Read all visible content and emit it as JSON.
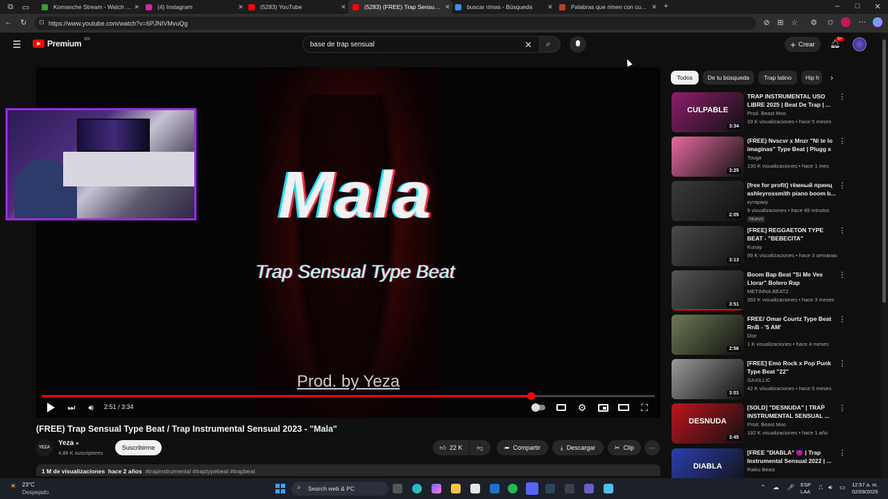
{
  "browser": {
    "tabs": [
      {
        "label": "Komanche Stream - Watch Live o",
        "color": "#3c9a3c",
        "active": false
      },
      {
        "label": "(4) Instagram",
        "color": "#d6249f",
        "active": false
      },
      {
        "label": "(5283) YouTube",
        "color": "#ff0000",
        "active": false
      },
      {
        "label": "(5283) (FREE) Trap Sensual Type Be",
        "color": "#ff0000",
        "active": true
      },
      {
        "label": "buscar rimas - Búsqueda",
        "color": "#3a8ee6",
        "active": false
      },
      {
        "label": "Palabras que rimen con cuello - L",
        "color": "#c0392b",
        "active": false
      }
    ],
    "url": "https://www.youtube.com/watch?v=6PJNIVMvuQg"
  },
  "header": {
    "logo_label": "Premium",
    "region": "MX",
    "search_value": "base de trap sensual",
    "create_label": "Crear",
    "notifications_badge": "9+"
  },
  "player": {
    "big_title": "Mala",
    "subtitle": "Trap Sensual Type Beat",
    "prod": "Prod. by Yeza",
    "time": "2:51 / 3:34",
    "progress": 0.797
  },
  "video": {
    "title": "(FREE) Trap Sensual Type Beat / Trap Instrumental Sensual 2023 - \"Mala\"",
    "channel": "Yeza",
    "channel_avatar_text": "YEZA",
    "subscribers": "4,86 K suscriptores",
    "subscribe_label": "Suscribirme",
    "likes": "22 K",
    "share_label": "Compartir",
    "download_label": "Descargar",
    "clip_label": "Clip",
    "views": "1 M de visualizaciones",
    "age": "hace 2 años",
    "tags": "#trapinstrumental #traptypebeat #trapbeat"
  },
  "chips": [
    "Todos",
    "De tu búsqueda",
    "Trap latino",
    "Hip h"
  ],
  "recommendations": [
    {
      "title": "TRAP INSTRUMENTAL USO LIBRE 2025 | Beat De Trap | ...",
      "channel": "Prod. Beast Moo",
      "views": "33 K visualizaciones",
      "age": "hace 5 meses",
      "duration": "3:34",
      "thumb_text": "CULPABLE",
      "thumb_color": "#8e1d6d",
      "badge": "",
      "watched": 0
    },
    {
      "title": "(FREE) Nvscvr x Mnzr \"Ni te lo imaginas\" Type Beat | Plugg x ...",
      "channel": "Touga",
      "views": "130 K visualizaciones",
      "age": "hace 1 mes",
      "duration": "3:25",
      "thumb_text": "",
      "thumb_color": "#e86aa0",
      "badge": "",
      "watched": 0
    },
    {
      "title": "[free for profit] тёмный принц ashleyrossmith piano boom b...",
      "channel": "кутараку",
      "views": "9 visualizaciones",
      "age": "hace 49 minutos",
      "duration": "2:05",
      "thumb_text": "",
      "thumb_color": "#3a3a3a",
      "badge": "Nuevo",
      "watched": 0
    },
    {
      "title": "[FREE] REGGAETON TYPE BEAT - \"BEBECITA\"",
      "channel": "Kunay",
      "views": "99 K visualizaciones",
      "age": "hace 3 semanas",
      "duration": "3:13",
      "thumb_text": "",
      "thumb_color": "#4a4a4a",
      "badge": "",
      "watched": 0
    },
    {
      "title": "Boom Bap Beat \"Si Me Ves Llorar\" Bolero Rap",
      "channel": "METIMNA BEATZ",
      "views": "392 K visualizaciones",
      "age": "hace 3 meses",
      "duration": "3:51",
      "thumb_text": "",
      "thumb_color": "#555555",
      "badge": "",
      "watched": 1
    },
    {
      "title": "FREE/ Omar Courtz Type Beat RnB - '5 AM'",
      "channel": "Dior",
      "views": "1 K visualizaciones",
      "age": "hace 4 meses",
      "duration": "2:56",
      "thumb_text": "",
      "thumb_color": "#6b7a52",
      "badge": "",
      "watched": 0
    },
    {
      "title": "[FREE] Emo Rock x Pop Punk Type Beat \"22\"",
      "channel": "GAXILLIC",
      "views": "42 K visualizaciones",
      "age": "hace 5 meses",
      "duration": "3:01",
      "thumb_text": "",
      "thumb_color": "#9a9a9a",
      "badge": "",
      "watched": 0
    },
    {
      "title": "[SOLD] \"DESNUDA\" | TRAP INSTRUMENTAL SENSUAL ...",
      "channel": "Prod. Beast Moo",
      "views": "192 K visualizaciones",
      "age": "hace 1 año",
      "duration": "3:45",
      "thumb_text": "DESNUDA",
      "thumb_color": "#c0141e",
      "badge": "",
      "watched": 0
    },
    {
      "title": "[FREE \"DIABLA\" 😈 | Trap Instrumental Sensual 2022 | ...",
      "channel": "Raiko Beatz",
      "views": "",
      "age": "",
      "duration": "",
      "thumb_text": "DIABLA",
      "thumb_color": "#2b3fb0",
      "badge": "",
      "watched": 0
    }
  ],
  "taskbar": {
    "temperature": "23°C",
    "weather": "Despejado",
    "search_label": "Search web & PC",
    "lang_1": "ESP",
    "lang_2": "LAA",
    "time": "12:57 a. m.",
    "date": "02/09/2025"
  }
}
